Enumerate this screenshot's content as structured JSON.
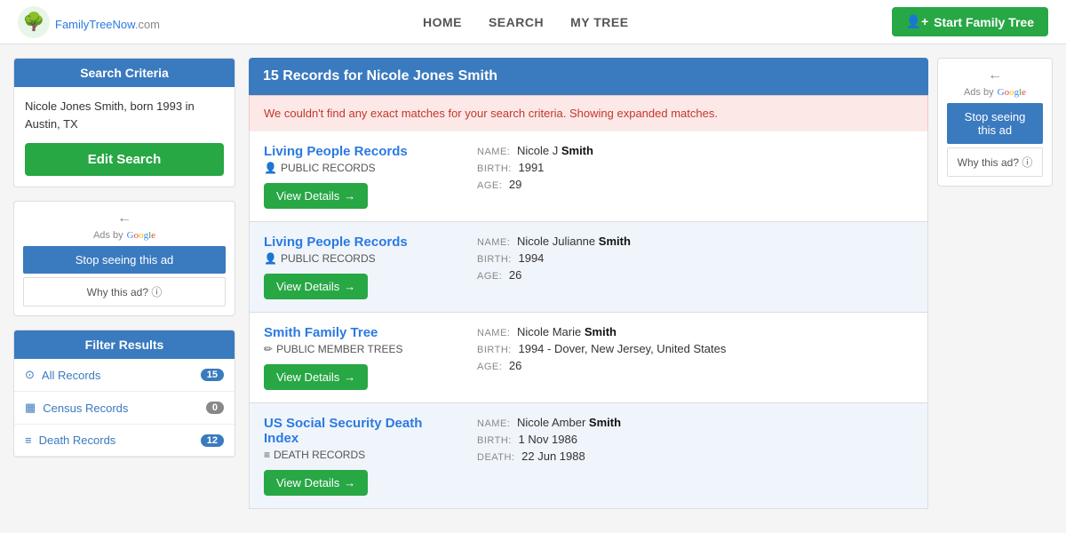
{
  "header": {
    "logo_text": "FamilyTreeNow",
    "logo_com": ".com",
    "nav": [
      {
        "label": "HOME",
        "id": "nav-home"
      },
      {
        "label": "SEARCH",
        "id": "nav-search"
      },
      {
        "label": "MY TREE",
        "id": "nav-mytree"
      }
    ],
    "start_btn": "Start Family Tree"
  },
  "left": {
    "search_criteria": {
      "header": "Search Criteria",
      "text": "Nicole Jones Smith, born 1993 in Austin, TX",
      "edit_btn": "Edit Search"
    },
    "ads": {
      "label": "Ads by Google",
      "stop_btn": "Stop seeing this ad",
      "why_btn": "Why this ad? ⓘ"
    },
    "filter": {
      "header": "Filter Results",
      "items": [
        {
          "icon": "⊙",
          "label": "All Records",
          "count": "15",
          "color": "blue"
        },
        {
          "icon": "▦",
          "label": "Census Records",
          "count": "0",
          "color": "gray"
        },
        {
          "icon": "≡",
          "label": "Death Records",
          "count": "12",
          "color": "blue"
        }
      ]
    }
  },
  "results": {
    "header": "15 Records for Nicole Jones Smith",
    "no_match_text": "We couldn't find any exact matches for your search criteria. Showing expanded matches.",
    "records": [
      {
        "type": "Living People Records",
        "sub_icon": "👤",
        "sub_label": "PUBLIC RECORDS",
        "view_btn": "View Details",
        "name_label": "NAME:",
        "name_first": "Nicole",
        "name_middle": "J",
        "name_last": "Smith",
        "birth_label": "BIRTH:",
        "birth_value": "1991",
        "age_label": "AGE:",
        "age_value": "29"
      },
      {
        "type": "Living People Records",
        "sub_icon": "👤",
        "sub_label": "PUBLIC RECORDS",
        "view_btn": "View Details",
        "name_label": "NAME:",
        "name_first": "Nicole",
        "name_middle": "Julianne",
        "name_last": "Smith",
        "birth_label": "BIRTH:",
        "birth_value": "1994",
        "age_label": "AGE:",
        "age_value": "26"
      },
      {
        "type": "Smith Family Tree",
        "sub_icon": "✏",
        "sub_label": "PUBLIC MEMBER TREES",
        "view_btn": "View Details",
        "name_label": "NAME:",
        "name_first": "Nicole",
        "name_middle": "Marie",
        "name_last": "Smith",
        "birth_label": "BIRTH:",
        "birth_value": "1994 - Dover, New Jersey, United States",
        "age_label": "AGE:",
        "age_value": "26"
      },
      {
        "type": "US Social Security Death Index",
        "sub_icon": "≡",
        "sub_label": "DEATH RECORDS",
        "view_btn": "View Details",
        "name_label": "NAME:",
        "name_first": "Nicole",
        "name_middle": "Amber",
        "name_last": "Smith",
        "birth_label": "BIRTH:",
        "birth_value": "1 Nov 1986",
        "death_label": "DEATH:",
        "death_value": "22 Jun 1988",
        "age_label": "",
        "age_value": ""
      }
    ]
  },
  "right_ads": {
    "label": "Ads by Google",
    "stop_btn": "Stop seeing this ad",
    "why_btn": "Why this ad? ⓘ"
  }
}
